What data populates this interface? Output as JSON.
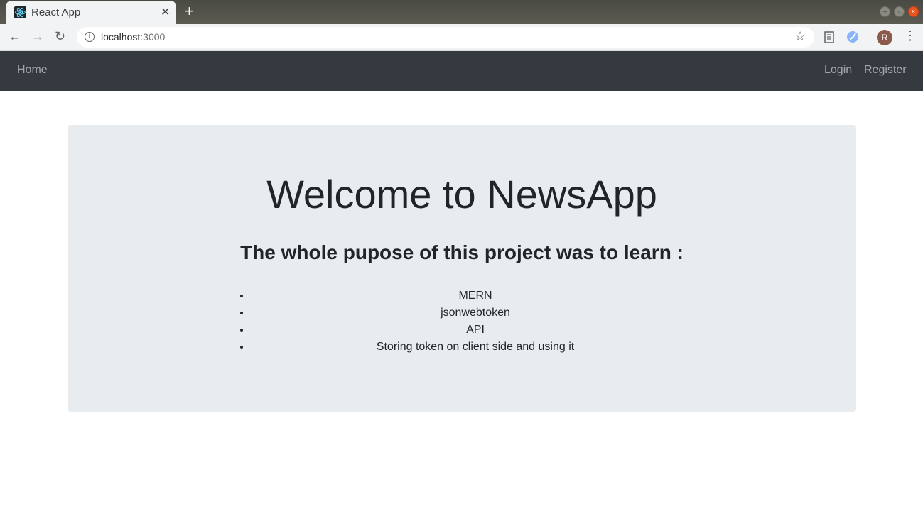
{
  "browser": {
    "tab_title": "React App",
    "tab_close": "✕",
    "new_tab": "+",
    "url_host": "localhost",
    "url_port": ":3000",
    "avatar_initial": "R"
  },
  "navbar": {
    "brand": "Home",
    "links": [
      "Login",
      "Register"
    ]
  },
  "jumbotron": {
    "title": "Welcome to NewsApp",
    "subtitle": "The whole pupose of this project was to learn :",
    "items": [
      "MERN",
      "jsonwebtoken",
      "API",
      "Storing token on client side and using it"
    ]
  },
  "colors": {
    "navbar_bg": "#343a40",
    "jumbotron_bg": "#e9ecef",
    "text": "#212529"
  }
}
